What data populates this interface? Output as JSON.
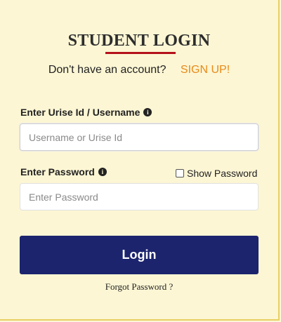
{
  "title": "STUDENT LOGIN",
  "signup": {
    "prompt": "Don't have an account?",
    "link": "SIGN UP!"
  },
  "username": {
    "label": "Enter Urise Id / Username",
    "placeholder": "Username or Urise Id"
  },
  "password": {
    "label": "Enter Password",
    "placeholder": "Enter Password",
    "show_label": "Show Password",
    "show_checked": false
  },
  "login_button": "Login",
  "forgot_link": "Forgot Password ?",
  "icons": {
    "info": "info-circle-icon"
  },
  "colors": {
    "background": "#fcf6d4",
    "accent_underline": "#b5121b",
    "signup_link": "#e88a1a",
    "button": "#1c246e"
  }
}
